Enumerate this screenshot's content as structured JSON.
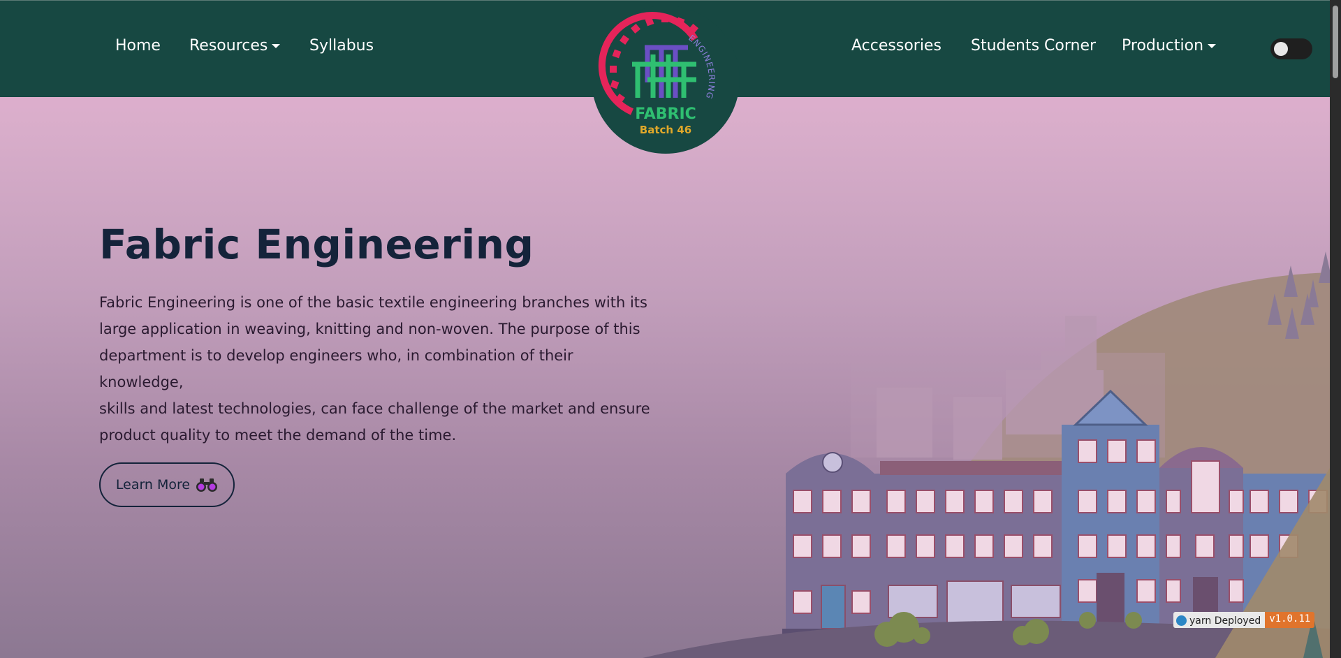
{
  "nav": {
    "left": [
      {
        "label": "Home"
      },
      {
        "label": "Resources",
        "dropdown": true
      },
      {
        "label": "Syllabus"
      }
    ],
    "right": [
      {
        "label": "Accessories"
      },
      {
        "label": "Students Corner"
      },
      {
        "label": "Production",
        "dropdown": true
      }
    ],
    "theme_toggle": {
      "state": "off"
    }
  },
  "logo": {
    "main_text": "FABRIC",
    "arc_text": "ENGINEERING",
    "sub_text": "Batch 46"
  },
  "hero": {
    "title": "Fabric Engineering",
    "lines": [
      "Fabric Engineering is one of the basic textile engineering branches with its",
      "large application in weaving, knitting and non-woven. The purpose of this",
      "department is to develop engineers who, in combination of their knowledge,",
      "skills and latest technologies, can face challenge of the market and ensure",
      "product quality to meet the demand of the time."
    ],
    "button_label": "Learn More",
    "button_icon": "binoculars-icon"
  },
  "badge": {
    "left_text": "yarn Deployed",
    "version": "v1.0.11"
  },
  "colors": {
    "navbar": "#174842",
    "title": "#14233a",
    "gear": "#e5245a",
    "logo_green": "#2fbf71",
    "logo_purple": "#6b4fc4",
    "logo_gold": "#e0a82a"
  }
}
